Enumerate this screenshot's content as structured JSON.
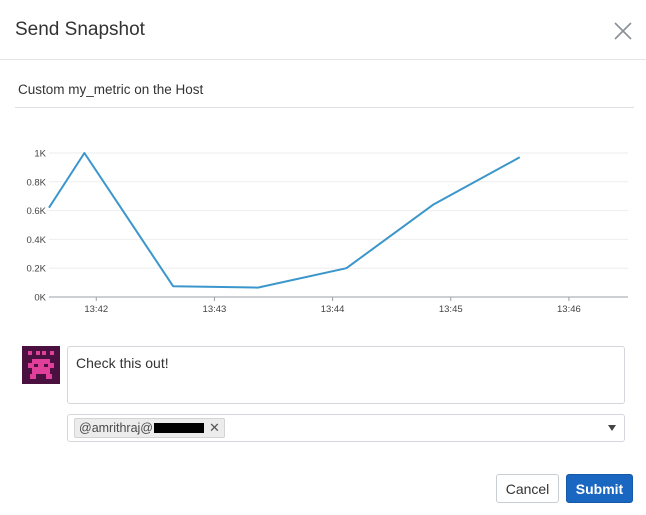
{
  "dialog": {
    "title": "Send Snapshot",
    "close_icon": "close-x-icon"
  },
  "graph": {
    "title": "Custom my_metric on the Host"
  },
  "chart_data": {
    "type": "line",
    "title": "Custom my_metric on the Host",
    "xlabel": "",
    "ylabel": "",
    "x_ticks": [
      "13:42",
      "13:43",
      "13:44",
      "13:45",
      "13:46"
    ],
    "y_ticks": [
      "0K",
      "0.2K",
      "0.4K",
      "0.6K",
      "0.8K",
      "1K"
    ],
    "ylim": [
      0,
      1000
    ],
    "xlim": [
      "13:41:36",
      "13:46:30"
    ],
    "grid": true,
    "series": [
      {
        "color": "#3a96cb",
        "x": [
          "13:41:36",
          "13:41:54",
          "13:42:39",
          "13:43:22",
          "13:44:07",
          "13:44:51",
          "13:45:35"
        ],
        "y": [
          620,
          1000,
          75,
          65,
          200,
          640,
          970
        ]
      }
    ]
  },
  "comment": {
    "avatar_icon": "user-avatar-icon",
    "text": "Check this out!"
  },
  "recipients": {
    "tags": [
      {
        "label": "@amrithraj@",
        "remove_icon": "remove-x-icon"
      }
    ],
    "dropdown_icon": "caret-down-icon"
  },
  "actions": {
    "cancel_label": "Cancel",
    "submit_label": "Submit",
    "submit_color": "#1a67c2"
  }
}
